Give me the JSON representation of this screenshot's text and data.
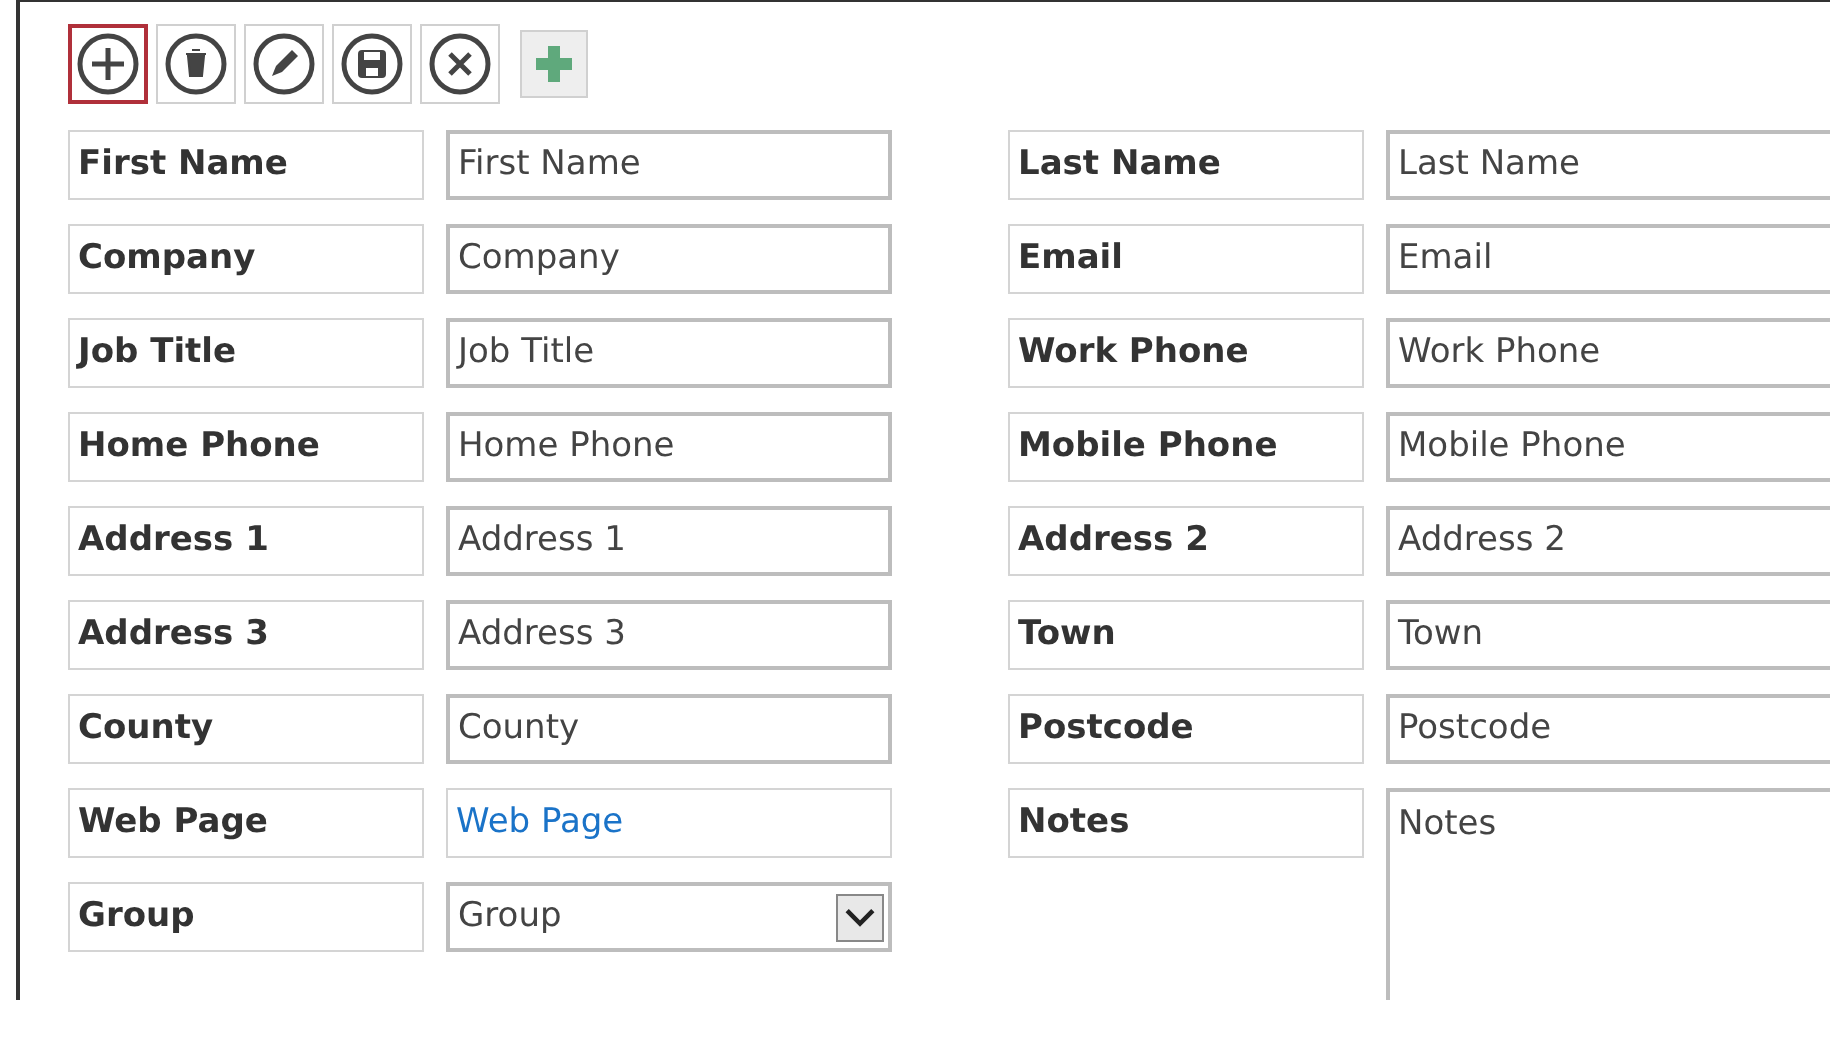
{
  "toolbar": [
    {
      "kind": "add",
      "selected": true
    },
    {
      "kind": "delete",
      "selected": false
    },
    {
      "kind": "edit",
      "selected": false
    },
    {
      "kind": "save",
      "selected": false
    },
    {
      "kind": "cancel",
      "selected": false
    },
    {
      "kind": "new",
      "selected": false
    }
  ],
  "fields": [
    {
      "label": "First Name",
      "kind": "text",
      "value": "First Name"
    },
    {
      "label": "Last Name",
      "kind": "text",
      "value": "Last Name"
    },
    {
      "label": "Company",
      "kind": "text",
      "value": "Company"
    },
    {
      "label": "Email",
      "kind": "text",
      "value": "Email"
    },
    {
      "label": "Job Title",
      "kind": "text",
      "value": "Job Title"
    },
    {
      "label": "Work Phone",
      "kind": "text",
      "value": "Work Phone"
    },
    {
      "label": "Home Phone",
      "kind": "text",
      "value": "Home Phone"
    },
    {
      "label": "Mobile Phone",
      "kind": "text",
      "value": "Mobile Phone"
    },
    {
      "label": "Address 1",
      "kind": "text",
      "value": "Address 1"
    },
    {
      "label": "Address 2",
      "kind": "text",
      "value": "Address 2"
    },
    {
      "label": "Address 3",
      "kind": "text",
      "value": "Address 3"
    },
    {
      "label": "Town",
      "kind": "text",
      "value": "Town"
    },
    {
      "label": "County",
      "kind": "text",
      "value": "County"
    },
    {
      "label": "Postcode",
      "kind": "text",
      "value": "Postcode"
    },
    {
      "label": "Web Page",
      "kind": "link",
      "value": "Web Page"
    },
    {
      "label": "Notes",
      "kind": "multiline",
      "value": "Notes"
    },
    {
      "label": "Group",
      "kind": "dropdown",
      "value": "Group"
    }
  ]
}
